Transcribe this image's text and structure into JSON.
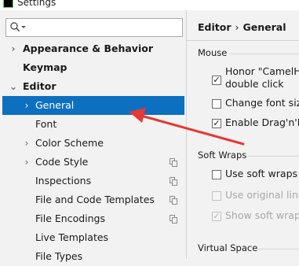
{
  "window": {
    "title": "Settings"
  },
  "search": {
    "placeholder": "",
    "value": ""
  },
  "sidebar": {
    "items": [
      {
        "label": "Appearance & Behavior",
        "expandable": true,
        "expanded": false,
        "bold": true
      },
      {
        "label": "Keymap",
        "bold": true
      },
      {
        "label": "Editor",
        "expandable": true,
        "expanded": true,
        "bold": true
      },
      {
        "label": "General",
        "expandable": true,
        "selected": true
      },
      {
        "label": "Font"
      },
      {
        "label": "Color Scheme",
        "expandable": true
      },
      {
        "label": "Code Style",
        "expandable": true,
        "has_copy_icon": true
      },
      {
        "label": "Inspections",
        "has_copy_icon": true
      },
      {
        "label": "File and Code Templates",
        "has_copy_icon": true
      },
      {
        "label": "File Encodings",
        "has_copy_icon": true
      },
      {
        "label": "Live Templates"
      },
      {
        "label": "File Types"
      }
    ]
  },
  "breadcrumb": {
    "parent": "Editor",
    "separator": "›",
    "current": "General"
  },
  "mouse": {
    "title": "Mouse",
    "options": [
      {
        "label": "Honor \"CamelHu",
        "label_line2": "double click",
        "checked": true,
        "enabled": true
      },
      {
        "label": "Change font size",
        "checked": false,
        "enabled": true
      },
      {
        "label": "Enable Drag'n'Dr",
        "checked": true,
        "enabled": true
      }
    ]
  },
  "soft_wraps": {
    "title": "Soft Wraps",
    "options": [
      {
        "label": "Use soft wraps in",
        "checked": false,
        "enabled": true
      },
      {
        "label": "Use original line'",
        "checked": false,
        "enabled": false
      },
      {
        "label": "Show soft wrap in",
        "checked": true,
        "enabled": false
      }
    ]
  },
  "virtual_space": {
    "title": "Virtual Space"
  },
  "colors": {
    "selection": "#0d6fbf",
    "annotation_arrow": "#e53935"
  }
}
